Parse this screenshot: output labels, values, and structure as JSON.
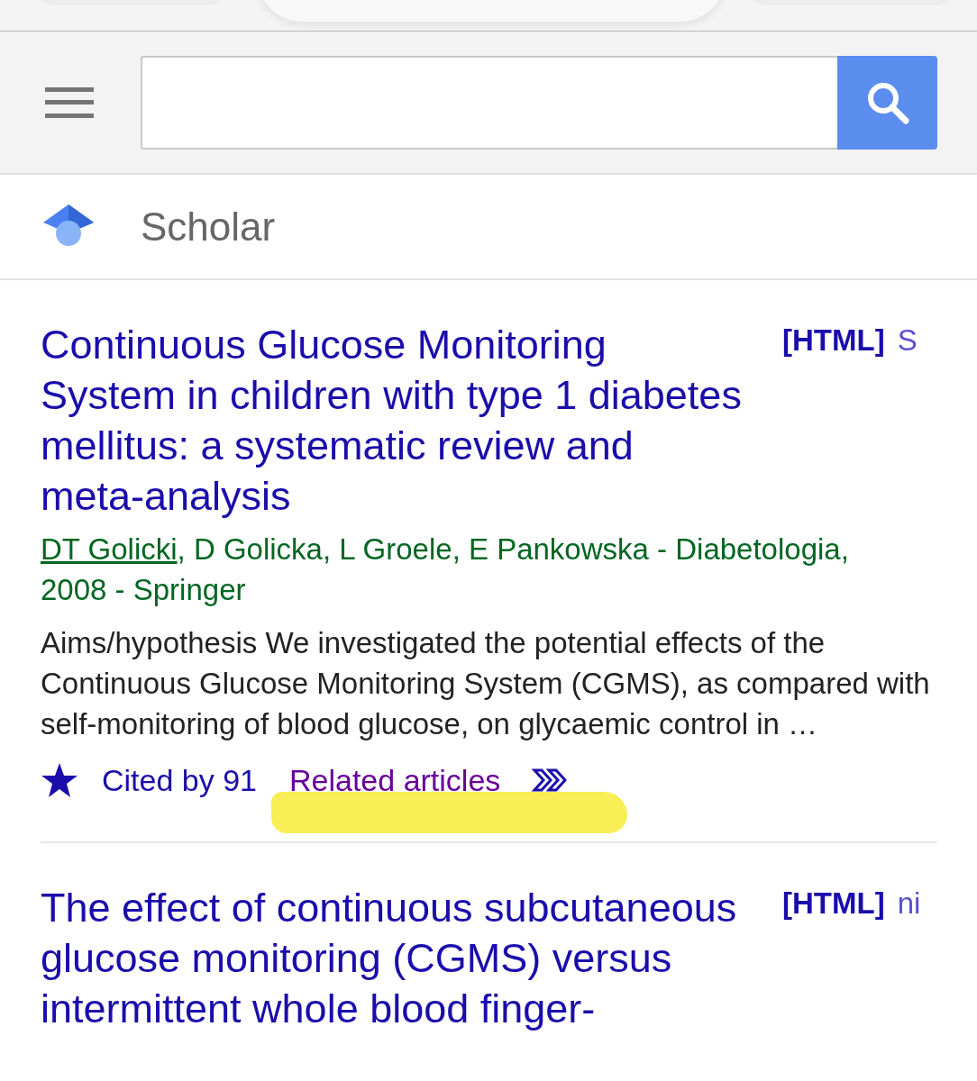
{
  "brand": {
    "title": "Scholar"
  },
  "results": [
    {
      "title": "Continuous Glucose Monitoring System in children with type 1 diabetes mellitus: a systematic review and meta-analysis",
      "format": "[HTML]",
      "source": "S",
      "author_link": "DT Golicki",
      "byline": ", D Golicka, L Groele, E Pankowska - Diabetologia,",
      "venue": "2008 - Springer",
      "snippet": "Aims/hypothesis We investigated the potential effects of the Continuous Glucose Monitoring System (CGMS), as compared with self-monitoring of blood glucose, on glycaemic control in …",
      "links": [
        {
          "kind": "cited",
          "label": "Cited by 91",
          "visited": false,
          "highlighted": false
        },
        {
          "kind": "related",
          "label": "Related articles",
          "visited": true,
          "highlighted": true
        }
      ]
    },
    {
      "title": "The effect of continuous subcutaneous glucose monitoring (CGMS) versus intermittent whole blood finger-",
      "format": "[HTML]",
      "source": "ni"
    }
  ]
}
